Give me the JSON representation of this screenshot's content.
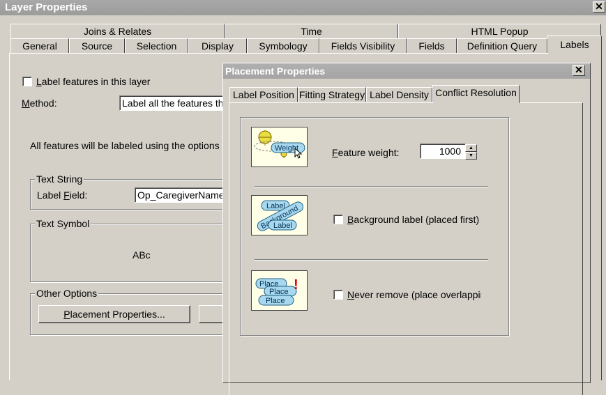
{
  "window": {
    "title": "Layer Properties",
    "close": "✕"
  },
  "tabs_row1": [
    "Joins & Relates",
    "Time",
    "HTML Popup"
  ],
  "tabs_row2": [
    "General",
    "Source",
    "Selection",
    "Display",
    "Symbology",
    "Fields Visibility",
    "Fields",
    "Definition Query",
    "Labels"
  ],
  "labels_tab": {
    "label_features": {
      "prefix": "",
      "accel": "L",
      "rest": "abel features in this layer",
      "checked": false
    },
    "method": {
      "accel": "M",
      "rest": "ethod:",
      "value": "Label all the features the"
    },
    "info_text": "All features will be labeled using the options sp",
    "text_string": {
      "group": "Text String",
      "field_label_pre": "Label ",
      "field_label_accel": "F",
      "field_label_rest": "ield:",
      "field_value": "Op_CaregiverName"
    },
    "text_symbol": {
      "group": "Text Symbol",
      "preview": "ABc"
    },
    "other_options": {
      "group": "Other Options",
      "placement_accel": "P",
      "placement_rest": "lacement Properties..."
    }
  },
  "dialog": {
    "title": "Placement Properties",
    "close": "✕",
    "tabs": [
      "Label Position",
      "Fitting Strategy",
      "Label Density",
      "Conflict Resolution"
    ],
    "feature_weight": {
      "accel": "F",
      "rest": "eature weight:",
      "value": "1000"
    },
    "background_label": {
      "accel": "B",
      "rest": "ackground label (placed first)",
      "checked": false
    },
    "never_remove": {
      "accel": "N",
      "rest": "ever remove (place overlapping)",
      "checked": false
    },
    "thumb1": {
      "text": "Weight"
    },
    "thumb2": {
      "top": "Label",
      "mid": "Background",
      "bottom": "Label"
    },
    "thumb3": {
      "line1": "Place",
      "line2": "Place",
      "line3": "Place",
      "mark": "!"
    }
  }
}
